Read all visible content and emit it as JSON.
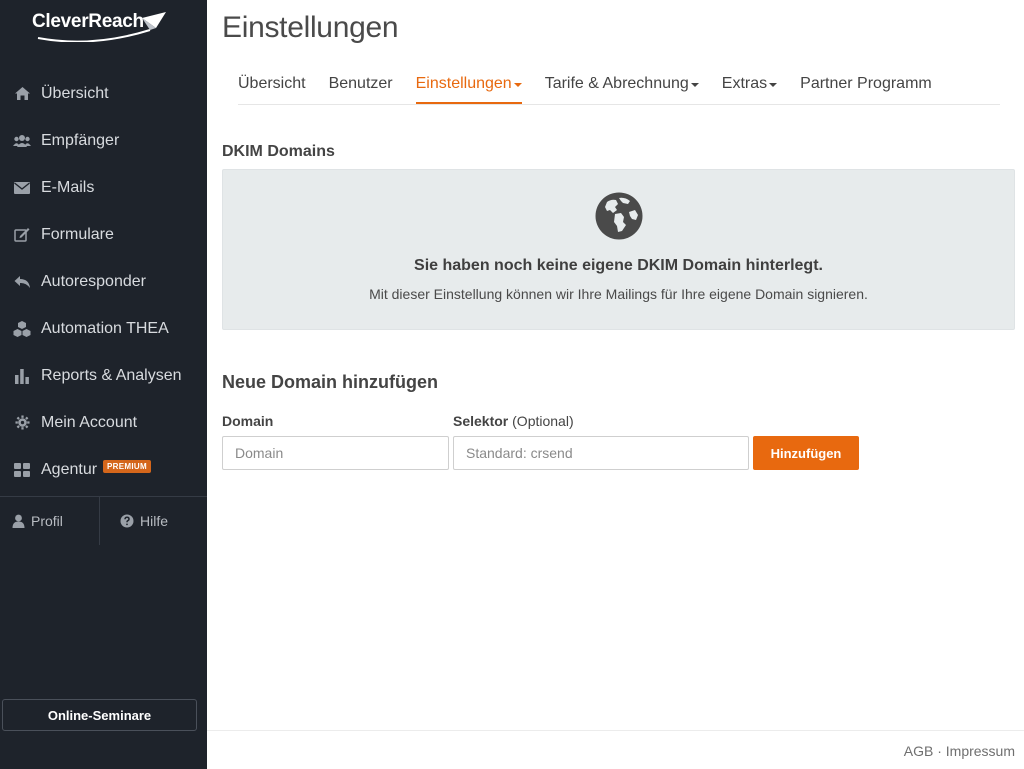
{
  "brand": {
    "logo_text": "CleverReach"
  },
  "sidebar": {
    "items": [
      {
        "label": "Übersicht",
        "icon": "home-icon"
      },
      {
        "label": "Empfänger",
        "icon": "users-icon"
      },
      {
        "label": "E-Mails",
        "icon": "envelope-icon"
      },
      {
        "label": "Formulare",
        "icon": "edit-icon"
      },
      {
        "label": "Autoresponder",
        "icon": "reply-icon"
      },
      {
        "label": "Automation THEA",
        "icon": "cubes-icon"
      },
      {
        "label": "Reports & Analysen",
        "icon": "bar-chart-icon"
      },
      {
        "label": "Mein Account",
        "icon": "gear-icon"
      },
      {
        "label": "Agentur",
        "icon": "grid-icon",
        "badge": "PREMIUM"
      }
    ],
    "profile_label": "Profil",
    "help_label": "Hilfe",
    "seminar_label": "Online-Seminare"
  },
  "header": {
    "title": "Einstellungen"
  },
  "tabs": [
    {
      "label": "Übersicht",
      "dropdown": false,
      "active": false
    },
    {
      "label": "Benutzer",
      "dropdown": false,
      "active": false
    },
    {
      "label": "Einstellungen",
      "dropdown": true,
      "active": true
    },
    {
      "label": "Tarife & Abrechnung",
      "dropdown": true,
      "active": false
    },
    {
      "label": "Extras",
      "dropdown": true,
      "active": false
    },
    {
      "label": "Partner Programm",
      "dropdown": false,
      "active": false
    }
  ],
  "dkim": {
    "section_title": "DKIM Domains",
    "empty_heading": "Sie haben noch keine eigene DKIM Domain hinterlegt.",
    "empty_sub": "Mit dieser Einstellung können wir Ihre Mailings für Ihre eigene Domain signieren.",
    "empty_icon": "globe-icon"
  },
  "add_domain": {
    "title": "Neue Domain hinzufügen",
    "domain_label": "Domain",
    "domain_placeholder": "Domain",
    "domain_value": "",
    "selector_label": "Selektor",
    "selector_optional": "(Optional)",
    "selector_placeholder": "Standard: crsend",
    "selector_value": "",
    "submit_label": "Hinzufügen"
  },
  "footer": {
    "agb": "AGB",
    "separator": "·",
    "impressum": "Impressum"
  },
  "colors": {
    "accent": "#e8690f",
    "sidebar_bg": "#1e232b",
    "badge": "#d4661b",
    "empty_bg": "#e7ebec"
  }
}
